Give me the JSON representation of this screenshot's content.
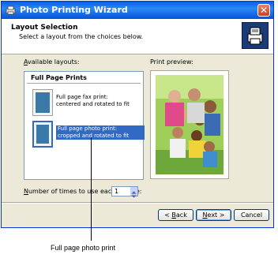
{
  "window": {
    "title": "Photo Printing Wizard",
    "close_glyph": "✕"
  },
  "header": {
    "title": "Layout Selection",
    "subtitle": "Select a layout from the choices below."
  },
  "layouts": {
    "label_prefix": "",
    "label_hotkey": "A",
    "label_rest": "vailable layouts:",
    "group": "Full Page Prints",
    "items": [
      {
        "line1": "Full page fax print:",
        "line2": "centered and rotated to fit",
        "selected": false
      },
      {
        "line1": "Full page photo print:",
        "line2": "cropped and rotated to fit",
        "selected": true
      }
    ]
  },
  "preview": {
    "label": "Print preview:"
  },
  "copies": {
    "label_hotkey": "N",
    "label_rest": "umber of times to use each picture:",
    "value": "1"
  },
  "buttons": {
    "back_hotkey": "B",
    "back_rest": "ack",
    "back_prefix": "< ",
    "next_hotkey": "N",
    "next_rest": "ext >",
    "cancel": "Cancel"
  },
  "callout": {
    "text": "Full page photo print"
  }
}
